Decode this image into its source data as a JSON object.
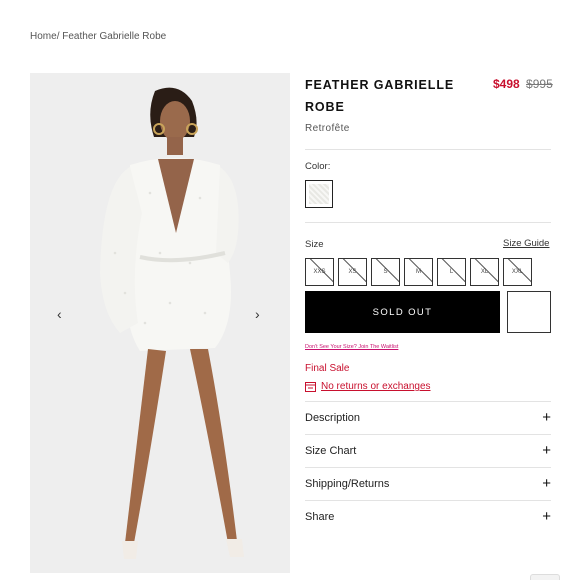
{
  "breadcrumb": {
    "home": "Home",
    "separator": "/",
    "current": " Feather Gabrielle Robe"
  },
  "gallery": {
    "prev_icon": "chevron-left-icon",
    "next_icon": "chevron-right-icon",
    "prev_glyph": "‹",
    "next_glyph": "›"
  },
  "product": {
    "title": "FEATHER GABRIELLE ROBE",
    "price_sale": "$498",
    "price_original": "$995",
    "brand": "Retrofête"
  },
  "color": {
    "label": "Color:"
  },
  "size": {
    "label": "Size",
    "guide_label": "Size Guide",
    "options": [
      "XXS",
      "XS",
      "S",
      "M",
      "L",
      "XL",
      "XXL"
    ]
  },
  "actions": {
    "sold_out_label": "SOLD OUT",
    "waitlist_label": "Don't See Your Size? Join The Waitlist"
  },
  "policy": {
    "final_sale": "Final Sale",
    "returns": "No returns or exchanges"
  },
  "accordion": {
    "items": [
      {
        "label": "Description",
        "icon": "+"
      },
      {
        "label": "Size Chart",
        "icon": "+"
      },
      {
        "label": "Shipping/Returns",
        "icon": "+"
      },
      {
        "label": "Share",
        "icon": "+"
      }
    ]
  },
  "colors": {
    "sale": "#c8102e",
    "accent_pink": "#c8106e",
    "button_bg": "#000000"
  }
}
